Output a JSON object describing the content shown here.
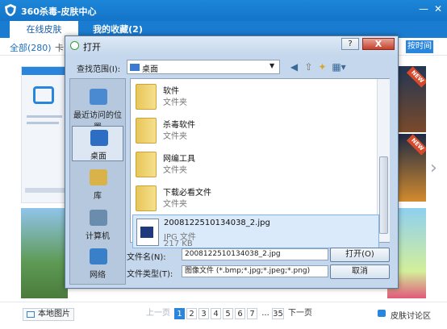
{
  "app": {
    "title": "360杀毒-皮肤中心"
  },
  "tabs": [
    {
      "label": "在线皮肤"
    },
    {
      "label": "我的收藏(2)"
    }
  ],
  "filter": {
    "all_label": "全部(280)",
    "partial_label": "卡",
    "sort_label": "按时间"
  },
  "badges": {
    "new": "NEW"
  },
  "bottom": {
    "local_button": "本地图片",
    "prev": "上一页",
    "pages": [
      "1",
      "2",
      "3",
      "4",
      "5",
      "6",
      "7"
    ],
    "ellipsis": "...",
    "last_page": "35",
    "next": "下一页",
    "discuss": "皮肤讨论区",
    "current_page": 1
  },
  "dialog": {
    "title": "打开",
    "help": "?",
    "close": "X",
    "lookin_label": "查找范围(I):",
    "lookin_value": "桌面",
    "places": [
      {
        "label": "最近访问的位置",
        "icon": "recent-places-icon"
      },
      {
        "label": "桌面",
        "icon": "desktop-icon",
        "selected": true
      },
      {
        "label": "库",
        "icon": "library-icon"
      },
      {
        "label": "计算机",
        "icon": "computer-icon"
      },
      {
        "label": "网络",
        "icon": "network-icon"
      }
    ],
    "files": [
      {
        "name": "软件",
        "type": "文件夹"
      },
      {
        "name": "杀毒软件",
        "type": "文件夹"
      },
      {
        "name": "网编工具",
        "type": "文件夹"
      },
      {
        "name": "下载必看文件",
        "type": "文件夹"
      },
      {
        "name": "2008122510134038_2.jpg",
        "type": "JPG 文件",
        "size": "217 KB",
        "selected": true
      }
    ],
    "filename_label": "文件名(N):",
    "filename_value": "2008122510134038_2.jpg",
    "filetype_label": "文件类型(T):",
    "filetype_value": "图像文件 (*.bmp;*.jpg;*.jpeg;*.png)",
    "open_button": "打开(O)",
    "cancel_button": "取消"
  },
  "colors": {
    "accent": "#1a7cd0",
    "dialog_bg": "#c4d7ec",
    "close_red": "#c4412c"
  }
}
